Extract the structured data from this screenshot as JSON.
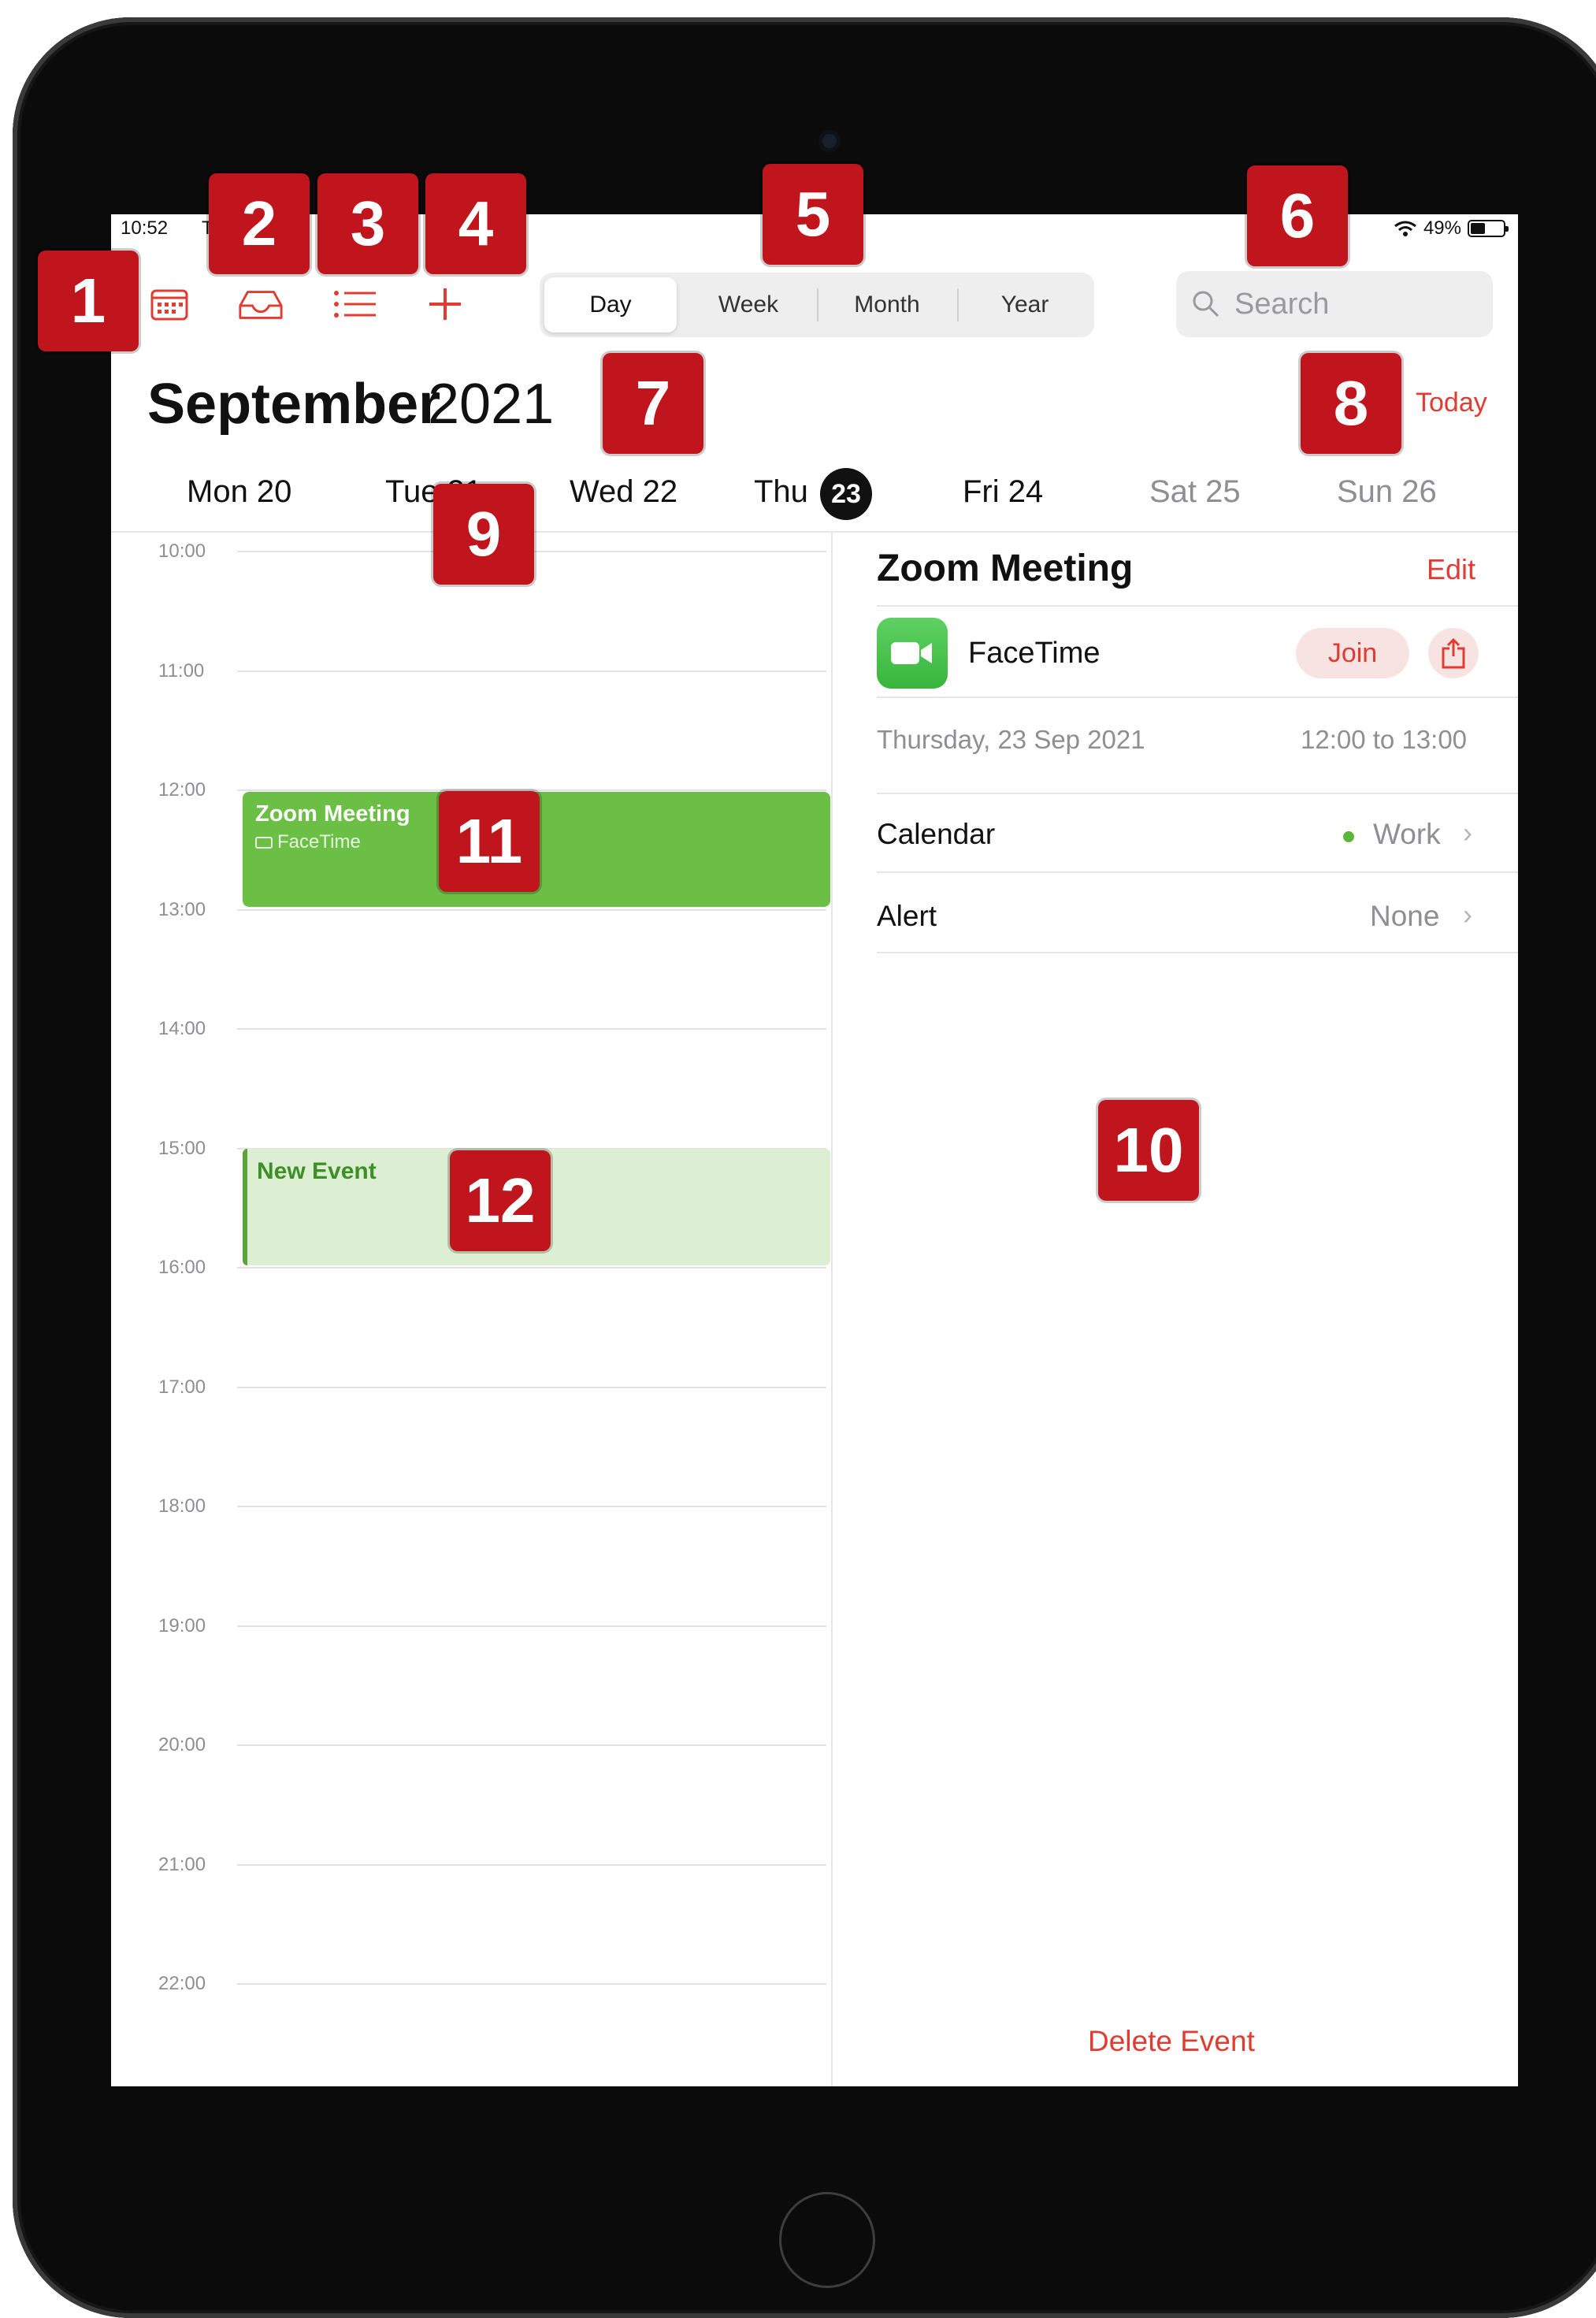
{
  "status_bar": {
    "time": "10:52",
    "date_fragment": "T",
    "battery_text": "49%",
    "wifi_icon": "wifi-icon"
  },
  "toolbar": {
    "icons": [
      "calendar-icon",
      "inbox-icon",
      "list-icon",
      "add-icon"
    ],
    "view_tabs": [
      {
        "label": "Day",
        "active": true
      },
      {
        "label": "Week",
        "active": false
      },
      {
        "label": "Month",
        "active": false
      },
      {
        "label": "Year",
        "active": false
      }
    ],
    "search_placeholder": "Search"
  },
  "header": {
    "month": "September",
    "year": "2021",
    "today_label": "Today"
  },
  "week_days": [
    {
      "label": "Mon 20",
      "weekend": false,
      "today": false
    },
    {
      "label": "Tue 21",
      "weekend": false,
      "today": false
    },
    {
      "label": "Wed 22",
      "weekend": false,
      "today": false
    },
    {
      "label": "Thu",
      "day_number": "23",
      "weekend": false,
      "today": true
    },
    {
      "label": "Fri 24",
      "weekend": false,
      "today": false
    },
    {
      "label": "Sat 25",
      "weekend": true,
      "today": false
    },
    {
      "label": "Sun 26",
      "weekend": true,
      "today": false
    }
  ],
  "timeline": {
    "hours": [
      "10:00",
      "11:00",
      "12:00",
      "13:00",
      "14:00",
      "15:00",
      "16:00",
      "17:00",
      "18:00",
      "19:00",
      "20:00",
      "21:00",
      "22:00"
    ],
    "events": [
      {
        "title": "Zoom Meeting",
        "subtitle": "FaceTime",
        "color": "#6bbf45"
      },
      {
        "title": "New Event",
        "color": "#dcefd3"
      }
    ]
  },
  "detail": {
    "title": "Zoom Meeting",
    "edit_label": "Edit",
    "app_name": "FaceTime",
    "join_label": "Join",
    "date": "Thursday, 23 Sep 2021",
    "time_range": "12:00 to 13:00",
    "calendar_label": "Calendar",
    "calendar_value": "Work",
    "calendar_color": "#5cb83b",
    "alert_label": "Alert",
    "alert_value": "None",
    "delete_label": "Delete Event"
  },
  "callouts": [
    "1",
    "2",
    "3",
    "4",
    "5",
    "6",
    "7",
    "8",
    "9",
    "10",
    "11",
    "12"
  ],
  "colors": {
    "accent": "#e03c31",
    "callout": "#c0151c"
  }
}
